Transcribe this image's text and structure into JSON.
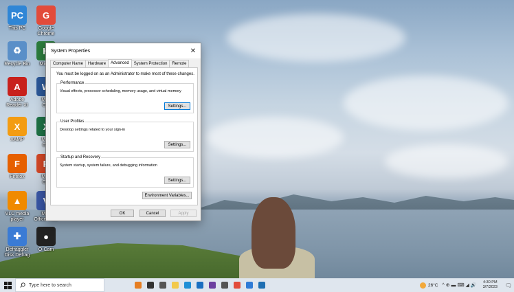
{
  "desktop": {
    "icons": [
      {
        "label": "This PC",
        "glyph": "PC",
        "color": "#2f86d6",
        "icon": "computer-icon"
      },
      {
        "label": "Google\nChrome",
        "glyph": "G",
        "color": "#e24b3a",
        "icon": "chrome-icon"
      },
      {
        "label": "Recycle Bin",
        "glyph": "♻",
        "color": "#5a8fc8",
        "icon": "recycle-bin-icon"
      },
      {
        "label": "Micr...",
        "glyph": "H",
        "color": "#2c7c3d",
        "icon": "app-icon"
      },
      {
        "label": "Adobe\nReader XI",
        "glyph": "A",
        "color": "#c8211c",
        "icon": "adobe-reader-icon"
      },
      {
        "label": "Micr\nOffi",
        "glyph": "W",
        "color": "#2b5797",
        "icon": "word-icon"
      },
      {
        "label": "XAMP",
        "glyph": "X",
        "color": "#f39c12",
        "icon": "xampp-icon"
      },
      {
        "label": "Micr\nOffi",
        "glyph": "X",
        "color": "#1e7145",
        "icon": "excel-icon"
      },
      {
        "label": "Firefox",
        "glyph": "F",
        "color": "#e66000",
        "icon": "firefox-icon"
      },
      {
        "label": "Micr\nOffi",
        "glyph": "P",
        "color": "#d24726",
        "icon": "powerpoint-icon"
      },
      {
        "label": "VLC media\nplayer",
        "glyph": "▲",
        "color": "#f08a00",
        "icon": "vlc-icon"
      },
      {
        "label": "Micr\nOffice Visio",
        "glyph": "V",
        "color": "#3955a3",
        "icon": "visio-icon"
      },
      {
        "label": "Defraggler\nDisk Defrag",
        "glyph": "✚",
        "color": "#3a7bd5",
        "icon": "defrag-icon"
      },
      {
        "label": "O-Cam",
        "glyph": "●",
        "color": "#222222",
        "icon": "ocam-icon"
      }
    ]
  },
  "dialog": {
    "title": "System Properties",
    "close": "✕",
    "tabs": [
      "Computer Name",
      "Hardware",
      "Advanced",
      "System Protection",
      "Remote"
    ],
    "active_tab": "Advanced",
    "notice": "You must be logged on as an Administrator to make most of these changes.",
    "performance": {
      "title": "Performance",
      "description": "Visual effects, processor scheduling, memory usage, and virtual memory",
      "button": "Settings..."
    },
    "user_profiles": {
      "title": "User Profiles",
      "description": "Desktop settings related to your sign-in",
      "button": "Settings..."
    },
    "startup_recovery": {
      "title": "Startup and Recovery",
      "description": "System startup, system failure, and debugging information",
      "button": "Settings..."
    },
    "env_button": "Environment Variables...",
    "ok": "OK",
    "cancel": "Cancel",
    "apply": "Apply"
  },
  "taskbar": {
    "search_placeholder": "Type here to search",
    "apps": [
      {
        "icon": "meet-now-icon",
        "color": "#e67e22"
      },
      {
        "icon": "cortana-icon",
        "color": "#333333"
      },
      {
        "icon": "task-view-icon",
        "color": "#555555"
      },
      {
        "icon": "file-explorer-icon",
        "color": "#f2c94c"
      },
      {
        "icon": "edge-icon",
        "color": "#1f8fd6"
      },
      {
        "icon": "mail-icon",
        "color": "#1a6fc1"
      },
      {
        "icon": "visual-studio-icon",
        "color": "#6b3fa0"
      },
      {
        "icon": "settings-icon",
        "color": "#555555"
      },
      {
        "icon": "chrome-icon",
        "color": "#e24b3a"
      },
      {
        "icon": "store-icon",
        "color": "#2f7bd6"
      },
      {
        "icon": "photos-icon",
        "color": "#1f6fb2"
      }
    ],
    "weather": "26°C",
    "tray_icons": "^  ⊕  ▬  ⌨  ◢  🔊",
    "time": "4:30 PM",
    "date": "3/7/2023",
    "notifications": "🗨"
  }
}
